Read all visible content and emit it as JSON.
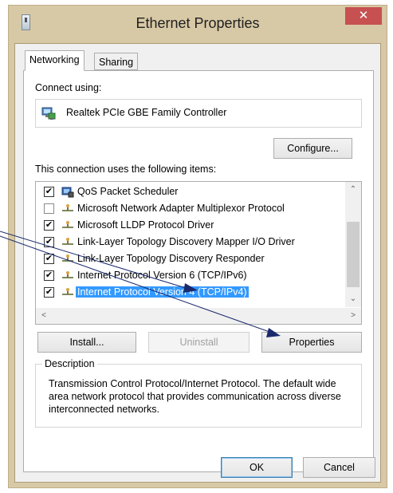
{
  "window": {
    "title": "Ethernet Properties",
    "close_label": "✕"
  },
  "tabs": [
    {
      "label": "Networking",
      "active": true
    },
    {
      "label": "Sharing",
      "active": false
    }
  ],
  "connect_using": {
    "label": "Connect using:",
    "adapter_name": "Realtek PCIe GBE Family Controller",
    "configure_label": "Configure..."
  },
  "items_section": {
    "label": "This connection uses the following items:",
    "items": [
      {
        "label": "QoS Packet Scheduler",
        "checked": true,
        "icon": "qos-scheduler-icon"
      },
      {
        "label": "Microsoft Network Adapter Multiplexor Protocol",
        "checked": false,
        "icon": "protocol-icon"
      },
      {
        "label": "Microsoft LLDP Protocol Driver",
        "checked": true,
        "icon": "protocol-icon"
      },
      {
        "label": "Link-Layer Topology Discovery Mapper I/O Driver",
        "checked": true,
        "icon": "protocol-icon"
      },
      {
        "label": "Link-Layer Topology Discovery Responder",
        "checked": true,
        "icon": "protocol-icon"
      },
      {
        "label": "Internet Protocol Version 6 (TCP/IPv6)",
        "checked": true,
        "icon": "protocol-icon"
      },
      {
        "label": "Internet Protocol Version 4 (TCP/IPv4)",
        "checked": true,
        "icon": "protocol-icon",
        "selected": true
      }
    ],
    "scroll_up": "⌃",
    "scroll_down": "⌄",
    "scroll_left": "<",
    "scroll_right": ">"
  },
  "actions": {
    "install_label": "Install...",
    "uninstall_label": "Uninstall",
    "properties_label": "Properties"
  },
  "description": {
    "legend": "Description",
    "text": "Transmission Control Protocol/Internet Protocol. The default wide area network protocol that provides communication across diverse interconnected networks."
  },
  "footer": {
    "ok_label": "OK",
    "cancel_label": "Cancel"
  },
  "colors": {
    "selection": "#3399ff",
    "close_button": "#c75050",
    "annotation_line": "#1a2a6c"
  }
}
